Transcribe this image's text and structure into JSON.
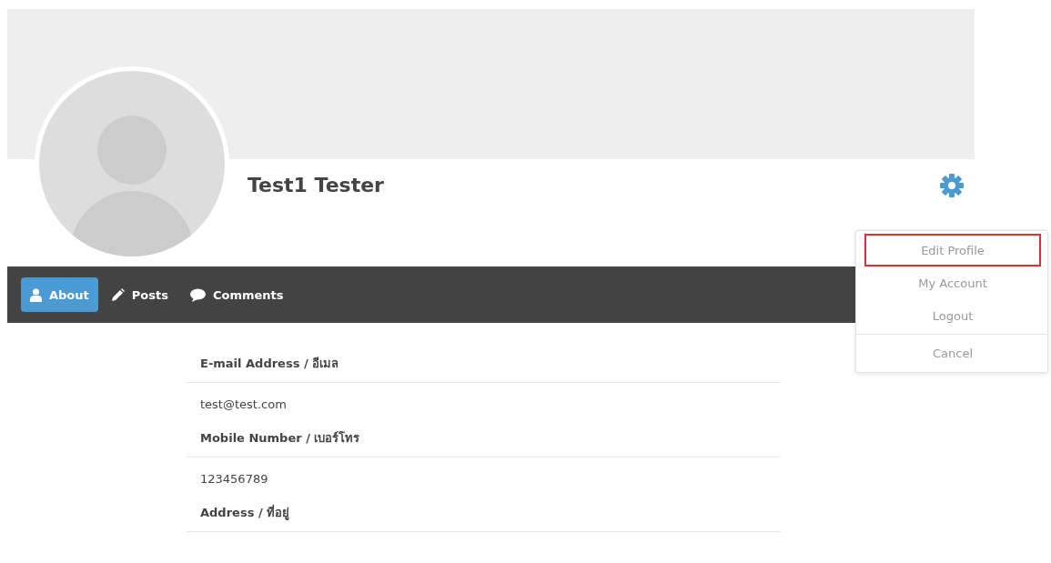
{
  "profile": {
    "name": "Test1 Tester"
  },
  "tabs": [
    {
      "label": "About",
      "kind": "user",
      "selected": true
    },
    {
      "label": "Posts",
      "kind": "pencil",
      "selected": false
    },
    {
      "label": "Comments",
      "kind": "comment",
      "selected": false
    }
  ],
  "menu": {
    "items": [
      {
        "label": "Edit Profile",
        "highlighted": true
      },
      {
        "label": "My Account",
        "highlighted": false
      },
      {
        "label": "Logout",
        "highlighted": false
      },
      {
        "label": "Cancel",
        "highlighted": false
      }
    ]
  },
  "fields": [
    {
      "label": "E-mail Address / อีเมล",
      "value": "test@test.com"
    },
    {
      "label": "Mobile Number / เบอร์โทร",
      "value": "123456789"
    },
    {
      "label": "Address / ที่อยู่"
    }
  ]
}
